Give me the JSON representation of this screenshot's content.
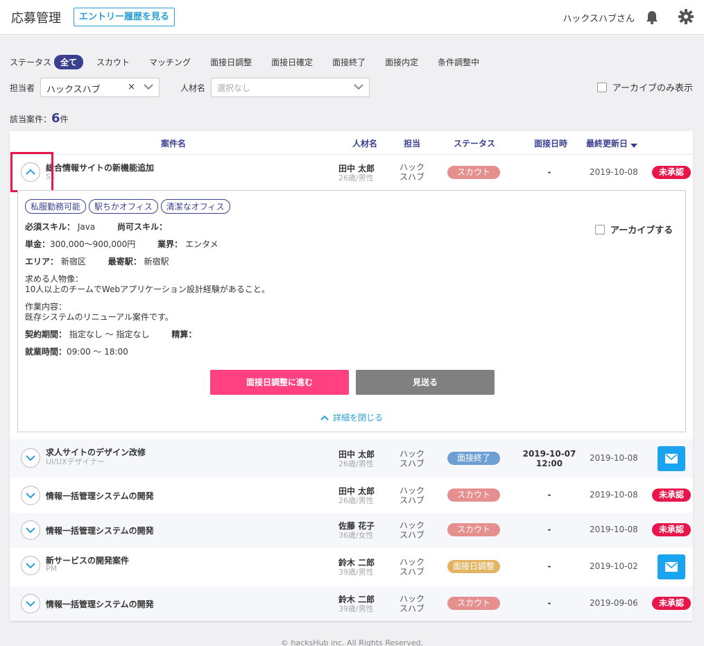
{
  "header": {
    "title": "応募管理",
    "history_button": "エントリー履歴を見る",
    "user": "ハックスハブさん",
    "bell_icon": "bell-icon",
    "gear_icon": "gear-icon"
  },
  "filters": {
    "status_label": "ステータス",
    "statuses": [
      "全て",
      "スカウト",
      "マッチング",
      "面接日調整",
      "面接日確定",
      "面接終了",
      "面接内定",
      "条件調整中"
    ],
    "active_status": "全て",
    "assignee_label": "担当者",
    "assignee_value": "ハックスハブ",
    "clear_glyph": "×",
    "candidate_label": "人材名",
    "candidate_placeholder": "選択なし",
    "archive_only_label": "アーカイブのみ表示"
  },
  "count": {
    "prefix": "該当案件：",
    "value": "6",
    "suffix": "件"
  },
  "table": {
    "headers": {
      "project": "案件名",
      "candidate": "人材名",
      "assignee": "担当",
      "status": "ステータス",
      "interview": "面接日時",
      "updated": "最終更新日",
      "sort_icon": "caret-down-icon"
    },
    "rows": [
      {
        "project": "総合情報サイトの新機能追加",
        "role": "SE",
        "candidate": "田中 太郎",
        "candidate_info": "26歳/男性",
        "assignee_1": "ハック",
        "assignee_2": "スハブ",
        "status": "スカウト",
        "status_color": "#e58f8f",
        "interview_1": "-",
        "interview_2": "",
        "updated": "2019-10-08",
        "action": "未承認"
      },
      {
        "project": "求人サイトのデザイン改修",
        "role": "UI/UXデザイナー",
        "candidate": "田中 太郎",
        "candidate_info": "26歳/男性",
        "assignee_1": "ハック",
        "assignee_2": "スハブ",
        "status": "面接終了",
        "status_color": "#6e9fd4",
        "interview_1": "2019-10-07",
        "interview_2": "12:00",
        "updated": "2019-10-08",
        "action": "mail-icon"
      },
      {
        "project": "情報一括管理システムの開発",
        "role": "",
        "candidate": "田中 太郎",
        "candidate_info": "26歳/男性",
        "assignee_1": "ハック",
        "assignee_2": "スハブ",
        "status": "スカウト",
        "status_color": "#e58f8f",
        "interview_1": "-",
        "interview_2": "",
        "updated": "2019-10-08",
        "action": "未承認"
      },
      {
        "project": "情報一括管理システムの開発",
        "role": "",
        "candidate": "佐藤 花子",
        "candidate_info": "36歳/女性",
        "assignee_1": "ハック",
        "assignee_2": "スハブ",
        "status": "スカウト",
        "status_color": "#e58f8f",
        "interview_1": "-",
        "interview_2": "",
        "updated": "2019-10-08",
        "action": "未承認"
      },
      {
        "project": "新サービスの開発案件",
        "role": "PM",
        "candidate": "鈴木 二郎",
        "candidate_info": "39歳/男性",
        "assignee_1": "ハック",
        "assignee_2": "スハブ",
        "status": "面接日調整",
        "status_color": "#e2b464",
        "interview_1": "-",
        "interview_2": "",
        "updated": "2019-10-02",
        "action": "mail-icon"
      },
      {
        "project": "情報一括管理システムの開発",
        "role": "",
        "candidate": "鈴木 二郎",
        "candidate_info": "39歳/男性",
        "assignee_1": "ハック",
        "assignee_2": "スハブ",
        "status": "スカウト",
        "status_color": "#e58f8f",
        "interview_1": "-",
        "interview_2": "",
        "updated": "2019-09-06",
        "action": "未承認"
      }
    ]
  },
  "detail": {
    "tags": [
      "私服勤務可能",
      "駅ちかオフィス",
      "清潔なオフィス"
    ],
    "required_skill_label": "必須スキル：",
    "required_skill": "Java",
    "preferred_skill_label": "尚可スキル：",
    "price_label": "単金：",
    "price": "300,000～900,000円",
    "industry_label": "業界：",
    "industry": "エンタメ",
    "area_label": "エリア：",
    "area": "新宿区",
    "station_label": "最寄駅：",
    "station": "新宿駅",
    "persona_label": "求める人物像：",
    "persona": "10人以上のチームでWebアプリケーション設計経験があること。",
    "work_label": "作業内容：",
    "work": "既存システムのリニューアル案件です。",
    "period_label": "契約期間：",
    "period": "指定なし ～ 指定なし",
    "settlement_label": "精算：",
    "hours_label": "就業時間：",
    "hours": "09:00 ～ 18:00",
    "archive_label": "アーカイブする",
    "primary_button": "面接日調整に進む",
    "secondary_button": "見送る",
    "close_label": "詳細を閉じる"
  },
  "footer": "© hacksHub inc. All Rights Reserved."
}
